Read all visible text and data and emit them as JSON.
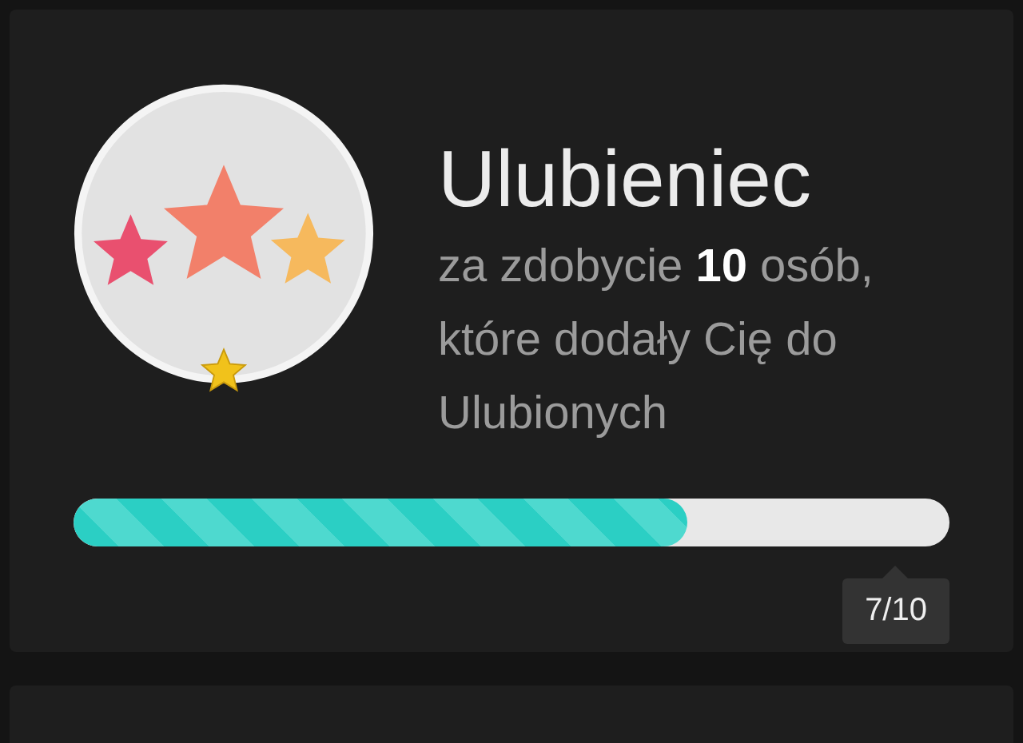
{
  "achievement": {
    "title": "Ulubieniec",
    "description": "za zdobycie **10** osób, które dodały Cię do Ulubionych",
    "progress": {
      "level": 0.7,
      "label": "7/10"
    }
  }
}
